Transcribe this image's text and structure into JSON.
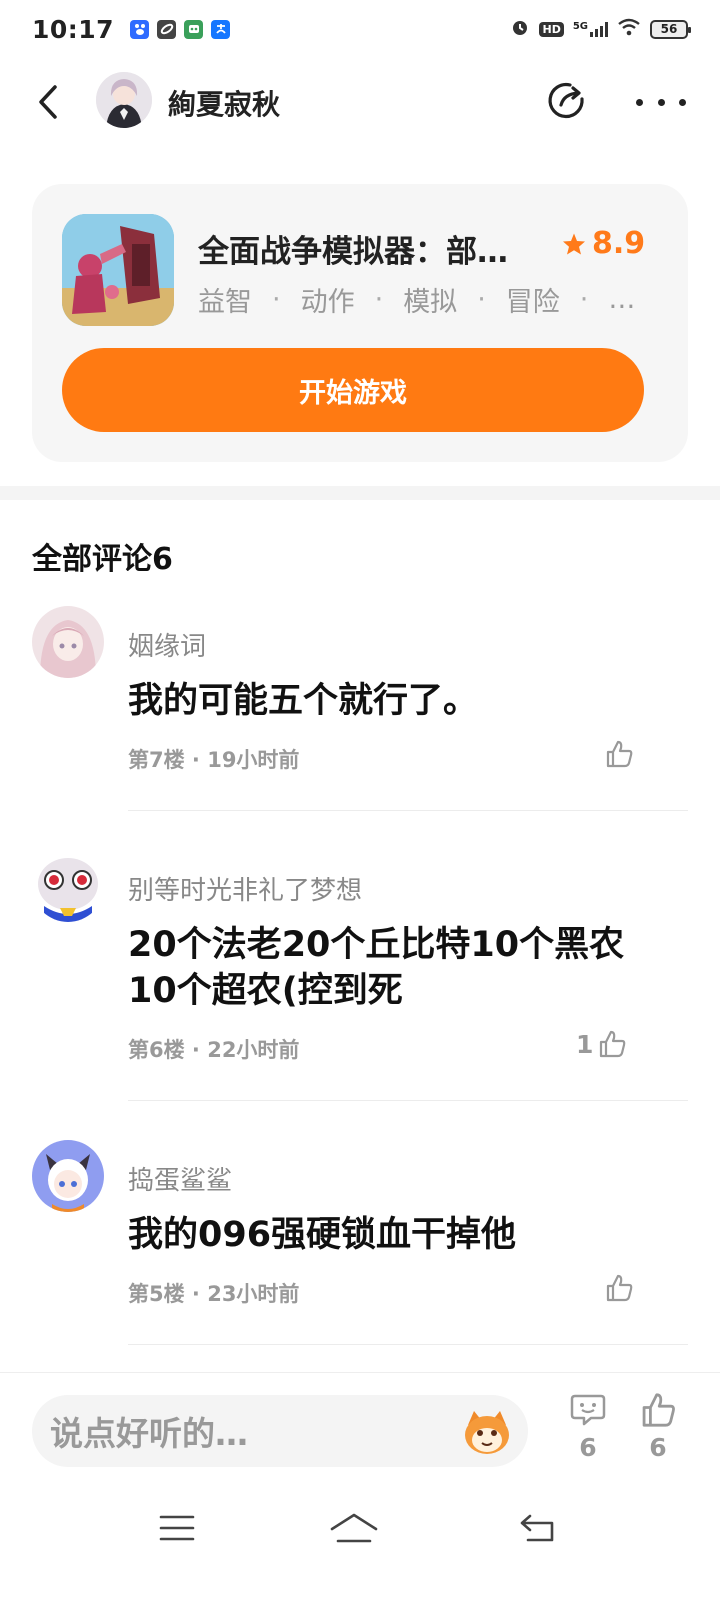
{
  "status_bar": {
    "time": "10:17",
    "network": "5G",
    "hd_label": "HD",
    "battery": "56"
  },
  "header": {
    "title": "絢夏寂秋",
    "icons": [
      "back-icon",
      "avatar",
      "share-icon",
      "more-icon"
    ]
  },
  "game_card": {
    "title": "全面战争模拟器：部…",
    "rating": "8.9",
    "tags": [
      "益智",
      "动作",
      "模拟",
      "冒险"
    ],
    "tags_more": "…",
    "start_label": "开始游戏",
    "accent_color": "#ff7a12"
  },
  "comments_section": {
    "title": "全部评论6"
  },
  "comments": [
    {
      "username": "姻缘词",
      "text": "我的可能五个就行了。",
      "meta": "第7楼 · 19小时前",
      "likes": ""
    },
    {
      "username": "别等时光非礼了梦想",
      "text": "20个法老20个丘比特10个黑农10个超农(控到死",
      "meta": "第6楼 · 22小时前",
      "likes": "1"
    },
    {
      "username": "捣蛋鲨鲨",
      "text": "我的096强硬锁血干掉他",
      "meta": "第5楼 · 23小时前",
      "likes": ""
    }
  ],
  "bottom_bar": {
    "input_placeholder": "说点好听的…",
    "comment_count": "6",
    "like_count": "6"
  }
}
